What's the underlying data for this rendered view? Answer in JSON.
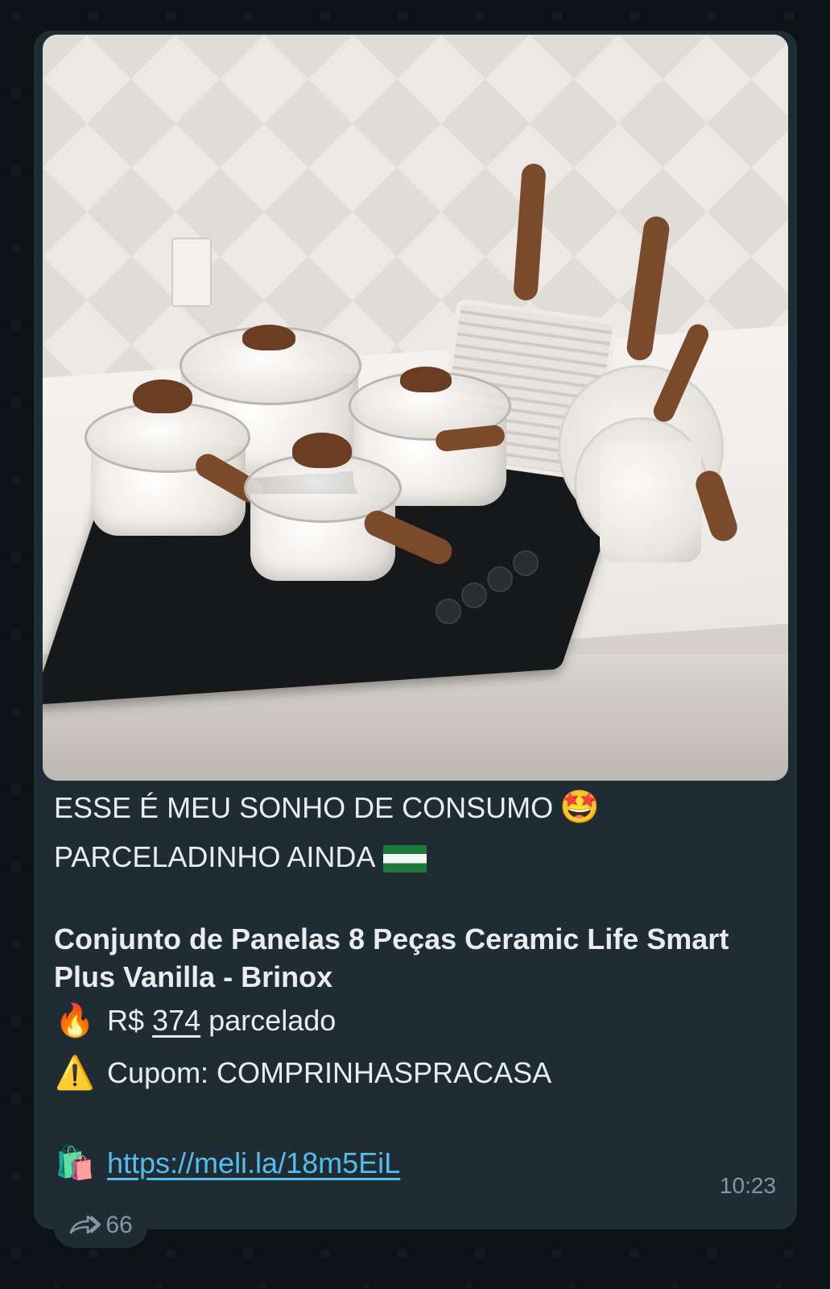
{
  "message": {
    "intro_line1": "ESSE É MEU SONHO DE CONSUMO",
    "intro_line1_emoji": "🤩",
    "intro_line2": "PARCELADINHO AINDA",
    "product_title": "Conjunto de Panelas 8 Peças Ceramic Life Smart Plus Vanilla - Brinox",
    "price_emoji": "🔥",
    "price_prefix": "R$",
    "price_value": "374",
    "price_suffix": "parcelado",
    "coupon_emoji": "⚠️",
    "coupon_text": "Cupom: COMPRINHASPRACASA",
    "link_emoji": "🛍️",
    "link_url": "https://meli.la/18m5EiL",
    "time": "10:23"
  },
  "forward": {
    "count": "66",
    "icon": "forward-icon"
  },
  "colors": {
    "background": "#0c1317",
    "bubble": "#202c33",
    "text": "#e9edef",
    "link": "#53bdeb",
    "meta": "#8696a0"
  }
}
